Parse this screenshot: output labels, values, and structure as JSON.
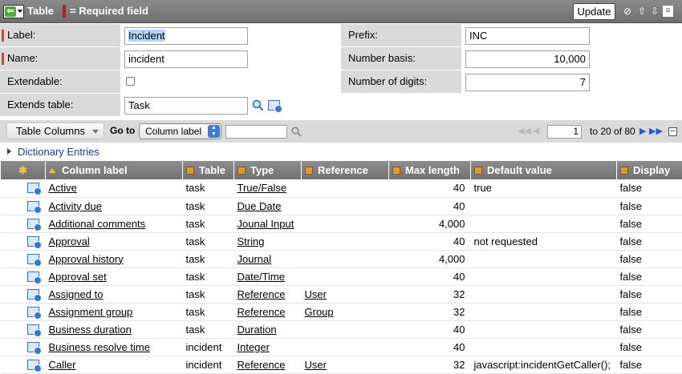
{
  "header": {
    "title": "Table",
    "required_legend": "= Required field",
    "update_label": "Update"
  },
  "form": {
    "label": {
      "label": "Label:",
      "value": "Incident"
    },
    "name": {
      "label": "Name:",
      "value": "incident"
    },
    "extendable": {
      "label": "Extendable:",
      "checked": false
    },
    "extends_table": {
      "label": "Extends table:",
      "value": "Task"
    },
    "prefix": {
      "label": "Prefix:",
      "value": "INC"
    },
    "number_basis": {
      "label": "Number basis:",
      "value": "10,000"
    },
    "number_digits": {
      "label": "Number of digits:",
      "value": "7"
    }
  },
  "list": {
    "title": "Table Columns",
    "goto_label": "Go to",
    "goto_field": "Column label",
    "page_input": "1",
    "page_text": "to 20 of 80",
    "related_link": "Dictionary Entries",
    "columns": [
      "Column label",
      "Table",
      "Type",
      "Reference",
      "Max length",
      "Default value",
      "Display"
    ],
    "rows": [
      {
        "label": "Active",
        "table": "task",
        "type": "True/False",
        "reference": "",
        "max": "40",
        "default": "true",
        "display": "false"
      },
      {
        "label": "Activity due",
        "table": "task",
        "type": "Due Date",
        "reference": "",
        "max": "40",
        "default": "",
        "display": "false"
      },
      {
        "label": "Additional comments",
        "table": "task",
        "type": "Jounal Input",
        "reference": "",
        "max": "4,000",
        "default": "",
        "display": "false"
      },
      {
        "label": "Approval",
        "table": "task",
        "type": "String",
        "reference": "",
        "max": "40",
        "default": "not requested",
        "display": "false"
      },
      {
        "label": "Approval history",
        "table": "task",
        "type": "Journal",
        "reference": "",
        "max": "4,000",
        "default": "",
        "display": "false"
      },
      {
        "label": "Approval set",
        "table": "task",
        "type": "Date/Time",
        "reference": "",
        "max": "40",
        "default": "",
        "display": "false"
      },
      {
        "label": "Assigned to",
        "table": "task",
        "type": "Reference",
        "reference": "User",
        "max": "32",
        "default": "",
        "display": "false"
      },
      {
        "label": "Assignment group",
        "table": "task",
        "type": "Reference",
        "reference": "Group",
        "max": "32",
        "default": "",
        "display": "false"
      },
      {
        "label": "Business duration",
        "table": "task",
        "type": "Duration",
        "reference": "",
        "max": "40",
        "default": "",
        "display": "false"
      },
      {
        "label": "Business resolve time",
        "table": "incident",
        "type": "Integer",
        "reference": "",
        "max": "40",
        "default": "",
        "display": "false"
      },
      {
        "label": "Caller",
        "table": "incident",
        "type": "Reference",
        "reference": "User",
        "max": "32",
        "default": "javascript:incidentGetCaller();",
        "display": "false"
      }
    ]
  },
  "colors": {
    "header_bg": "#7d7d7d",
    "label_bg": "#dadada",
    "link": "#1c3d9a",
    "mandatory": "#a02a2a"
  }
}
